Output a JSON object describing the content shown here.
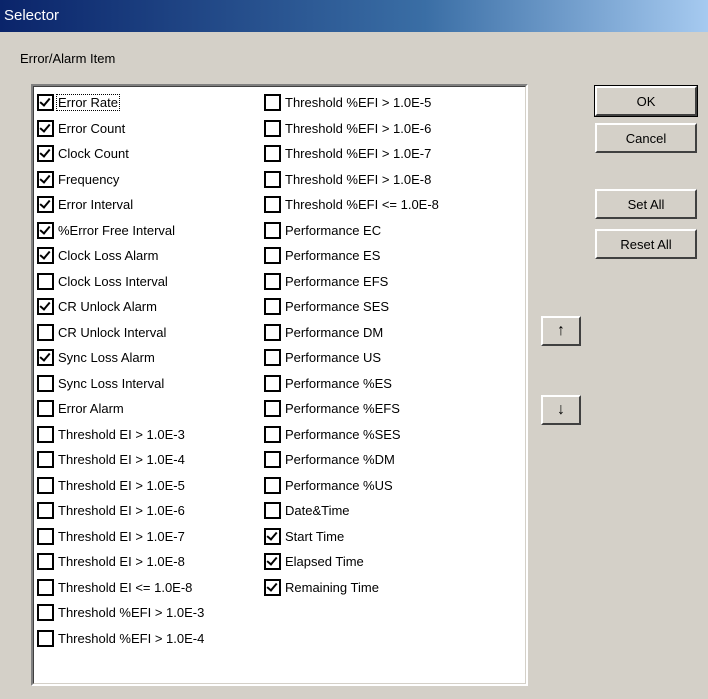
{
  "window": {
    "title": "Selector"
  },
  "group_label": "Error/Alarm Item",
  "items_col1": [
    {
      "label": "Error Rate",
      "checked": true,
      "focused": true
    },
    {
      "label": "Error Count",
      "checked": true
    },
    {
      "label": "Clock Count",
      "checked": true
    },
    {
      "label": "Frequency",
      "checked": true
    },
    {
      "label": "Error Interval",
      "checked": true
    },
    {
      "label": "%Error Free Interval",
      "checked": true
    },
    {
      "label": "Clock Loss Alarm",
      "checked": true
    },
    {
      "label": "Clock Loss Interval",
      "checked": false
    },
    {
      "label": "CR Unlock Alarm",
      "checked": true
    },
    {
      "label": "CR Unlock Interval",
      "checked": false
    },
    {
      "label": "Sync Loss Alarm",
      "checked": true
    },
    {
      "label": "Sync Loss Interval",
      "checked": false
    },
    {
      "label": "Error Alarm",
      "checked": false
    },
    {
      "label": "Threshold EI > 1.0E-3",
      "checked": false
    },
    {
      "label": "Threshold EI > 1.0E-4",
      "checked": false
    },
    {
      "label": "Threshold EI > 1.0E-5",
      "checked": false
    },
    {
      "label": "Threshold EI > 1.0E-6",
      "checked": false
    },
    {
      "label": "Threshold EI > 1.0E-7",
      "checked": false
    },
    {
      "label": "Threshold EI > 1.0E-8",
      "checked": false
    },
    {
      "label": "Threshold EI <= 1.0E-8",
      "checked": false
    },
    {
      "label": "Threshold %EFI > 1.0E-3",
      "checked": false
    },
    {
      "label": "Threshold %EFI > 1.0E-4",
      "checked": false
    }
  ],
  "items_col2": [
    {
      "label": "Threshold %EFI > 1.0E-5",
      "checked": false
    },
    {
      "label": "Threshold %EFI > 1.0E-6",
      "checked": false
    },
    {
      "label": "Threshold %EFI > 1.0E-7",
      "checked": false
    },
    {
      "label": "Threshold %EFI > 1.0E-8",
      "checked": false
    },
    {
      "label": "Threshold %EFI <= 1.0E-8",
      "checked": false
    },
    {
      "label": "Performance EC",
      "checked": false
    },
    {
      "label": "Performance ES",
      "checked": false
    },
    {
      "label": "Performance EFS",
      "checked": false
    },
    {
      "label": "Performance SES",
      "checked": false
    },
    {
      "label": "Performance DM",
      "checked": false
    },
    {
      "label": "Performance US",
      "checked": false
    },
    {
      "label": "Performance %ES",
      "checked": false
    },
    {
      "label": "Performance %EFS",
      "checked": false
    },
    {
      "label": "Performance %SES",
      "checked": false
    },
    {
      "label": "Performance %DM",
      "checked": false
    },
    {
      "label": "Performance %US",
      "checked": false
    },
    {
      "label": "Date&Time",
      "checked": false
    },
    {
      "label": "Start Time",
      "checked": true
    },
    {
      "label": "Elapsed Time",
      "checked": true
    },
    {
      "label": "Remaining Time",
      "checked": true
    }
  ],
  "buttons": {
    "ok": "OK",
    "cancel": "Cancel",
    "set_all": "Set All",
    "reset_all": "Reset All",
    "move_up": "↑",
    "move_down": "↓"
  }
}
